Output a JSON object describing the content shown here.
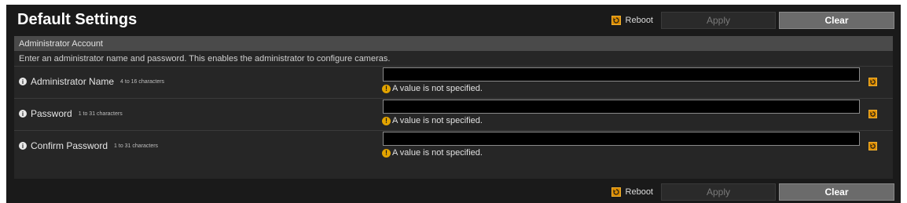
{
  "page": {
    "title": "Default Settings"
  },
  "actions": {
    "reboot_label": "Reboot",
    "apply_label": "Apply",
    "clear_label": "Clear"
  },
  "section": {
    "title": "Administrator Account",
    "description": "Enter an administrator name and password. This enables the administrator to configure cameras."
  },
  "fields": [
    {
      "label": "Administrator Name",
      "hint": "4 to 16 characters",
      "value": "",
      "warning": "A value is not specified."
    },
    {
      "label": "Password",
      "hint": "1 to 31 characters",
      "value": "",
      "warning": "A value is not specified."
    },
    {
      "label": "Confirm Password",
      "hint": "1 to 31 characters",
      "value": "",
      "warning": "A value is not specified."
    }
  ],
  "colors": {
    "background": "#1a1a1a",
    "panel": "#262626",
    "header": "#4a4a4a",
    "accent_orange": "#d98a00",
    "warning_yellow": "#e3a400"
  },
  "icons": {
    "reboot": "reboot-icon",
    "info": "info-icon",
    "warning": "warning-icon",
    "reset": "reset-icon"
  }
}
